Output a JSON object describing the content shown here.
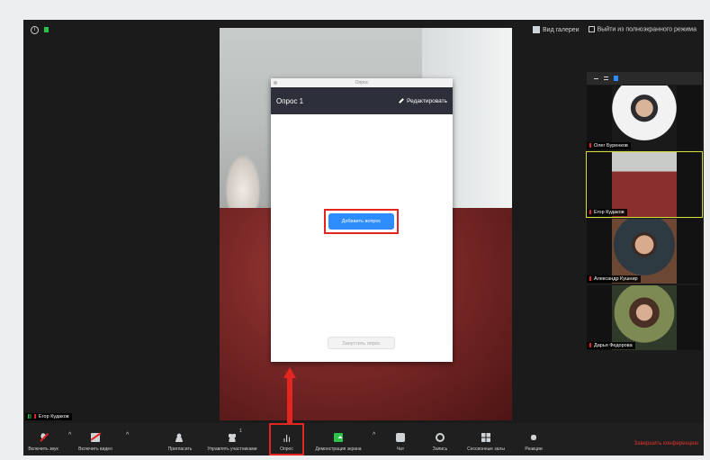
{
  "topbar": {
    "view_label": "Вид галереи",
    "exit_fullscreen_label": "Выйти из полноэкранного режима"
  },
  "poll_dialog": {
    "window_title": "Опрос",
    "poll_title": "Опрос 1",
    "edit_label": "Редактировать",
    "add_question_label": "Добавить вопрос",
    "launch_poll_label": "Запустить опрос"
  },
  "participants": [
    {
      "name": "Олег Буренков"
    },
    {
      "name": "Егор Кудаков"
    },
    {
      "name": "Александр Кушнир"
    },
    {
      "name": "Дарья Федорова"
    }
  ],
  "active_speaker": "Егор Кудаков",
  "toolbar": {
    "unmute_label": "Включить звук",
    "start_video_label": "Включить видео",
    "invite_label": "Пригласить",
    "manage_participants_label": "Управлять участниками",
    "participants_count": "1",
    "polls_label": "Опрос",
    "share_screen_label": "Демонстрация экрана",
    "chat_label": "Чат",
    "record_label": "Запись",
    "breakout_rooms_label": "Сессионные залы",
    "reactions_label": "Реакции",
    "end_meeting_label": "Завершить конференцию"
  },
  "colors": {
    "accent_blue": "#2d8cff",
    "highlight_red": "#e52620",
    "share_green": "#2bc24a"
  }
}
